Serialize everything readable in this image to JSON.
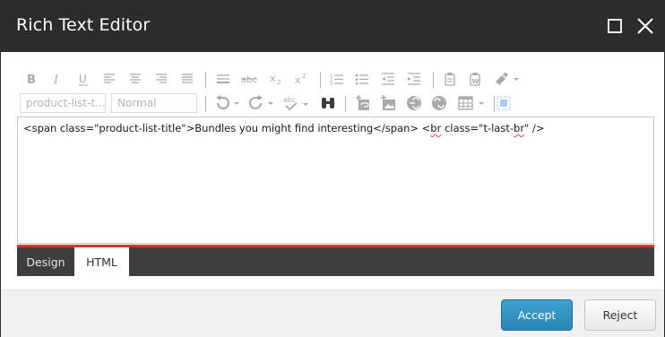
{
  "dialog": {
    "title": "Rich Text Editor",
    "maximize_icon": "maximize-icon",
    "close_icon": "close-icon"
  },
  "toolbar": {
    "row1": [
      "bold-icon",
      "italic-icon",
      "underline-icon",
      "align-left-icon",
      "align-center-icon",
      "align-right-icon",
      "align-justify-icon",
      "horizontal-rule-icon",
      "strikethrough-icon",
      "subscript-icon",
      "superscript-icon",
      "ordered-list-icon",
      "unordered-list-icon",
      "outdent-icon",
      "indent-icon",
      "paste-icon",
      "paste-word-icon",
      "format-painter-icon"
    ],
    "row2": [
      "undo-icon",
      "redo-icon",
      "spellcheck-icon",
      "find-icon",
      "insert-link-icon",
      "insert-image-icon",
      "link-icon",
      "unlink-icon",
      "table-icon",
      "select-all-icon"
    ],
    "css_class_select": "product-list-t...",
    "paragraph_select": "Normal"
  },
  "editor": {
    "html_part1": "<span class=\"product-list-title\">Bundles you might find interesting</span> <",
    "html_squiggle1": "br",
    "html_part2": " class=\"t-last-",
    "html_squiggle2": "br",
    "html_part3": "\" />"
  },
  "tabs": {
    "design": "Design",
    "html": "HTML",
    "active": "HTML"
  },
  "buttons": {
    "accept": "Accept",
    "reject": "Reject"
  },
  "colors": {
    "titlebar": "#2c2c2c",
    "accent_red": "#d9352b",
    "accept_blue": "#2a86b6",
    "tabbar": "#3e3e3e"
  }
}
